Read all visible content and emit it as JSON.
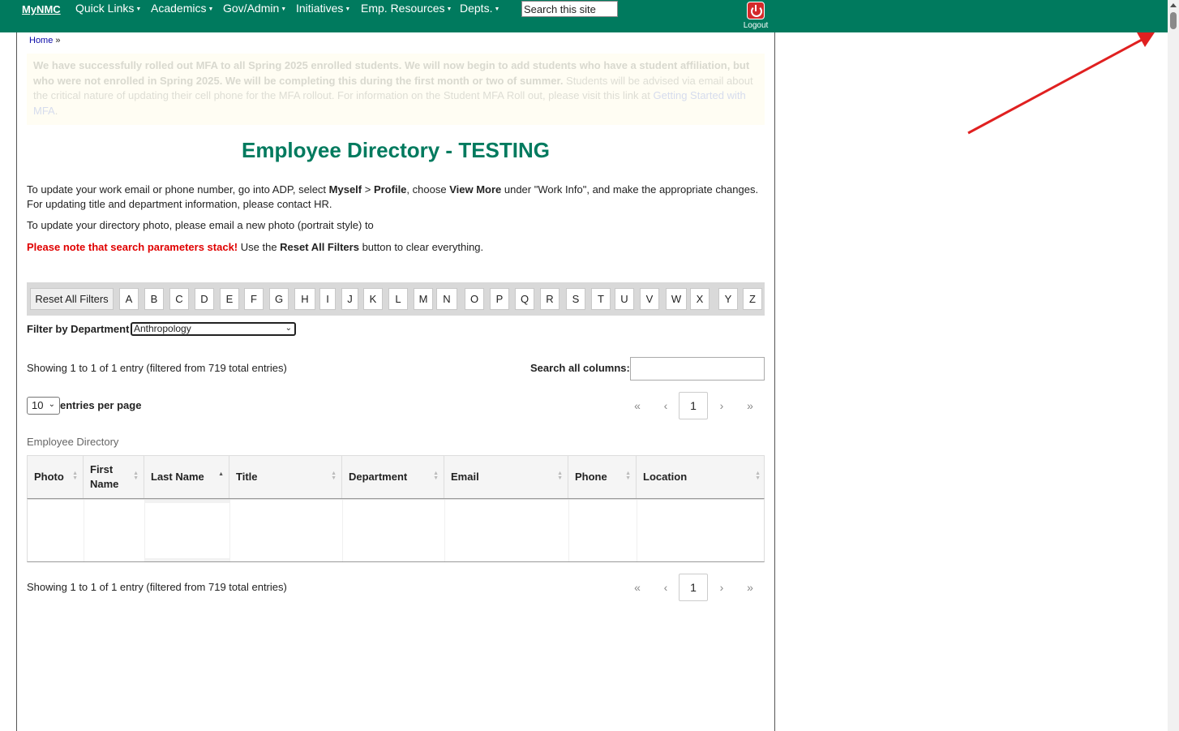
{
  "nav": {
    "brand": "MyNMC",
    "items": [
      "Quick Links",
      "Academics",
      "Gov/Admin",
      "Initiatives",
      "Emp. Resources",
      "Depts."
    ],
    "search_value": "Search this site",
    "logout": "Logout"
  },
  "breadcrumb": {
    "home": "Home",
    "sep": "»"
  },
  "notice": {
    "bold_text": "We have successfully rolled out MFA to all Spring 2025 enrolled students. We will now begin to add students who have a student affiliation, but who were not enrolled in Spring 2025.  We will be completing this during the first month or two of summer.",
    "text": " Students will be advised via email about the critical nature of updating their cell phone for the MFA rollout. For information on the Student MFA Roll out, please visit this link at ",
    "link": "Getting Started with MFA",
    "end": "."
  },
  "page": {
    "title": "Employee Directory - TESTING",
    "p1_a": "To update your work email or phone number, go into ADP, select ",
    "p1_myself": "Myself",
    "p1_gt": " > ",
    "p1_profile": "Profile",
    "p1_b": ", choose ",
    "p1_viewmore": "View More",
    "p1_c": " under \"Work Info\", and make the appropriate changes. For updating title and department information, please contact HR.",
    "p2": "To update your directory photo, please email a new photo (portrait style) to",
    "p3_warn": "Please note that search parameters stack!",
    "p3_a": " Use the ",
    "p3_reset": "Reset All Filters",
    "p3_b": " button to clear everything."
  },
  "filters": {
    "reset_label": "Reset All Filters",
    "letters": [
      "A",
      "B",
      "C",
      "D",
      "E",
      "F",
      "G",
      "H",
      "I",
      "J",
      "K",
      "L",
      "M",
      "N",
      "O",
      "P",
      "Q",
      "R",
      "S",
      "T",
      "U",
      "V",
      "W",
      "X",
      "Y",
      "Z"
    ],
    "dept_label": "Filter by Department",
    "dept_value": "Anthropology"
  },
  "table_controls": {
    "info": "Showing 1 to 1 of 1 entry (filtered from 719 total entries)",
    "search_label": "Search all columns:",
    "length_value": "10",
    "length_label": "entries per page",
    "pager": {
      "first": "«",
      "prev": "‹",
      "current": "1",
      "next": "›",
      "last": "»"
    }
  },
  "table": {
    "caption": "Employee Directory",
    "columns": [
      {
        "label": "Photo",
        "sort": "both"
      },
      {
        "label": "First Name",
        "sort": "both"
      },
      {
        "label": "Last Name",
        "sort": "asc"
      },
      {
        "label": "Title",
        "sort": "both"
      },
      {
        "label": "Department",
        "sort": "both"
      },
      {
        "label": "Email",
        "sort": "both"
      },
      {
        "label": "Phone",
        "sort": "both"
      },
      {
        "label": "Location",
        "sort": "both"
      }
    ]
  },
  "colors": {
    "brand": "#007a5e",
    "warning": "#e00000",
    "annotation": "#e02020"
  }
}
